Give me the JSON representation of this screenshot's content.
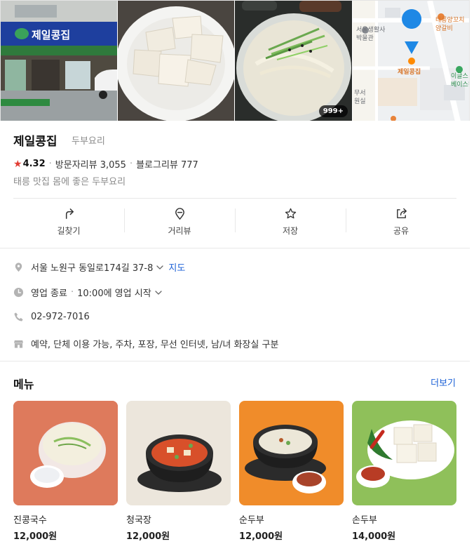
{
  "photos": {
    "more_count": "999+",
    "sign_text": "제일콩집",
    "map": {
      "marker_label": "제일콩집",
      "poi_museum": "서울생활사\n박물관",
      "poi_kebab": "태릉양꼬치\n양갈비",
      "poi_store": "이글스\n베이스캠",
      "poi_street": "무서\n원실"
    }
  },
  "place": {
    "name": "제일콩집",
    "category": "두부요리",
    "rating": "4.32",
    "visitor_reviews": "방문자리뷰 3,055",
    "blog_reviews": "블로그리뷰 777",
    "description": "태릉 맛집 몸에 좋은 두부요리"
  },
  "actions": [
    {
      "label": "길찾기",
      "icon": "directions-icon"
    },
    {
      "label": "거리뷰",
      "icon": "street-view-icon"
    },
    {
      "label": "저장",
      "icon": "star-outline-icon"
    },
    {
      "label": "공유",
      "icon": "share-icon"
    }
  ],
  "info": {
    "address": "서울 노원구 동일로174길 37-8",
    "map_link": "지도",
    "hours_status": "영업 종료",
    "hours_next": "10:00에 영업 시작",
    "phone": "02-972-7016",
    "amenities": "예약, 단체 이용 가능, 주차, 포장, 무선 인터넷, 남/녀 화장실 구분"
  },
  "menu": {
    "title": "메뉴",
    "more": "더보기",
    "items": [
      {
        "name": "진콩국수",
        "price": "12,000원"
      },
      {
        "name": "청국장",
        "price": "12,000원"
      },
      {
        "name": "순두부",
        "price": "12,000원"
      },
      {
        "name": "손두부",
        "price": "14,000원"
      }
    ]
  },
  "colors": {
    "accent_link": "#1a5fd6",
    "rating_star": "#e23c33",
    "map_pin": "#1e88e5"
  }
}
